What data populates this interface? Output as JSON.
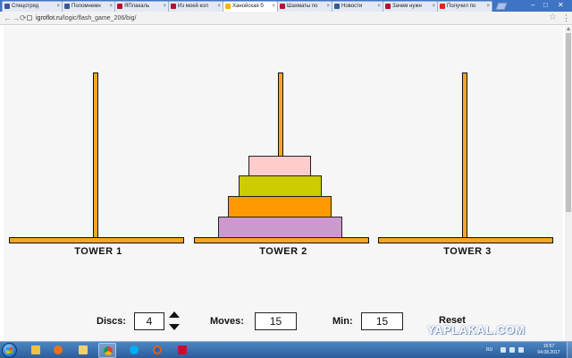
{
  "browser": {
    "tabs": [
      {
        "label": "Спецотряд",
        "active": false,
        "favicon_color": "#3b5998"
      },
      {
        "label": "Поломнемн",
        "active": false,
        "favicon_color": "#3b5998"
      },
      {
        "label": "ЯПлакаль",
        "active": false,
        "favicon_color": "#b5122f"
      },
      {
        "label": "Из моей кол",
        "active": false,
        "favicon_color": "#b5122f"
      },
      {
        "label": "Ханойская б",
        "active": true,
        "favicon_color": "#f5b400"
      },
      {
        "label": "Шахматы по",
        "active": false,
        "favicon_color": "#b5122f"
      },
      {
        "label": "Новости",
        "active": false,
        "favicon_color": "#3b5998"
      },
      {
        "label": "Зачем нужн",
        "active": false,
        "favicon_color": "#b5122f"
      },
      {
        "label": "Получил по",
        "active": false,
        "favicon_color": "#e62117"
      }
    ],
    "url_host": "igroflot.ru",
    "url_path": "/logic/flash_game_206/big/"
  },
  "game": {
    "towers": [
      {
        "label": "TOWER 1",
        "discs": []
      },
      {
        "label": "TOWER 2",
        "discs": [
          {
            "color": "#ffcccc"
          },
          {
            "color": "#cccc00"
          },
          {
            "color": "#ff9900"
          },
          {
            "color": "#cc99cc"
          }
        ]
      },
      {
        "label": "TOWER 3",
        "discs": []
      }
    ],
    "controls": {
      "discs_label": "Discs:",
      "discs_value": "4",
      "moves_label": "Moves:",
      "moves_value": "15",
      "min_label": "Min:",
      "min_value": "15",
      "reset_label": "Reset"
    },
    "colors": {
      "post": "#f5a623",
      "outline": "#111111"
    }
  },
  "watermark": "YAPLAKAL.COM",
  "taskbar": {
    "language": "RU",
    "time": "15:57",
    "date": "04.08.2017",
    "icons": [
      "windows-explorer-icon",
      "media-player-icon",
      "folder-icon",
      "chrome-icon",
      "skype-icon",
      "firefox-icon",
      "pdf-reader-icon"
    ]
  }
}
